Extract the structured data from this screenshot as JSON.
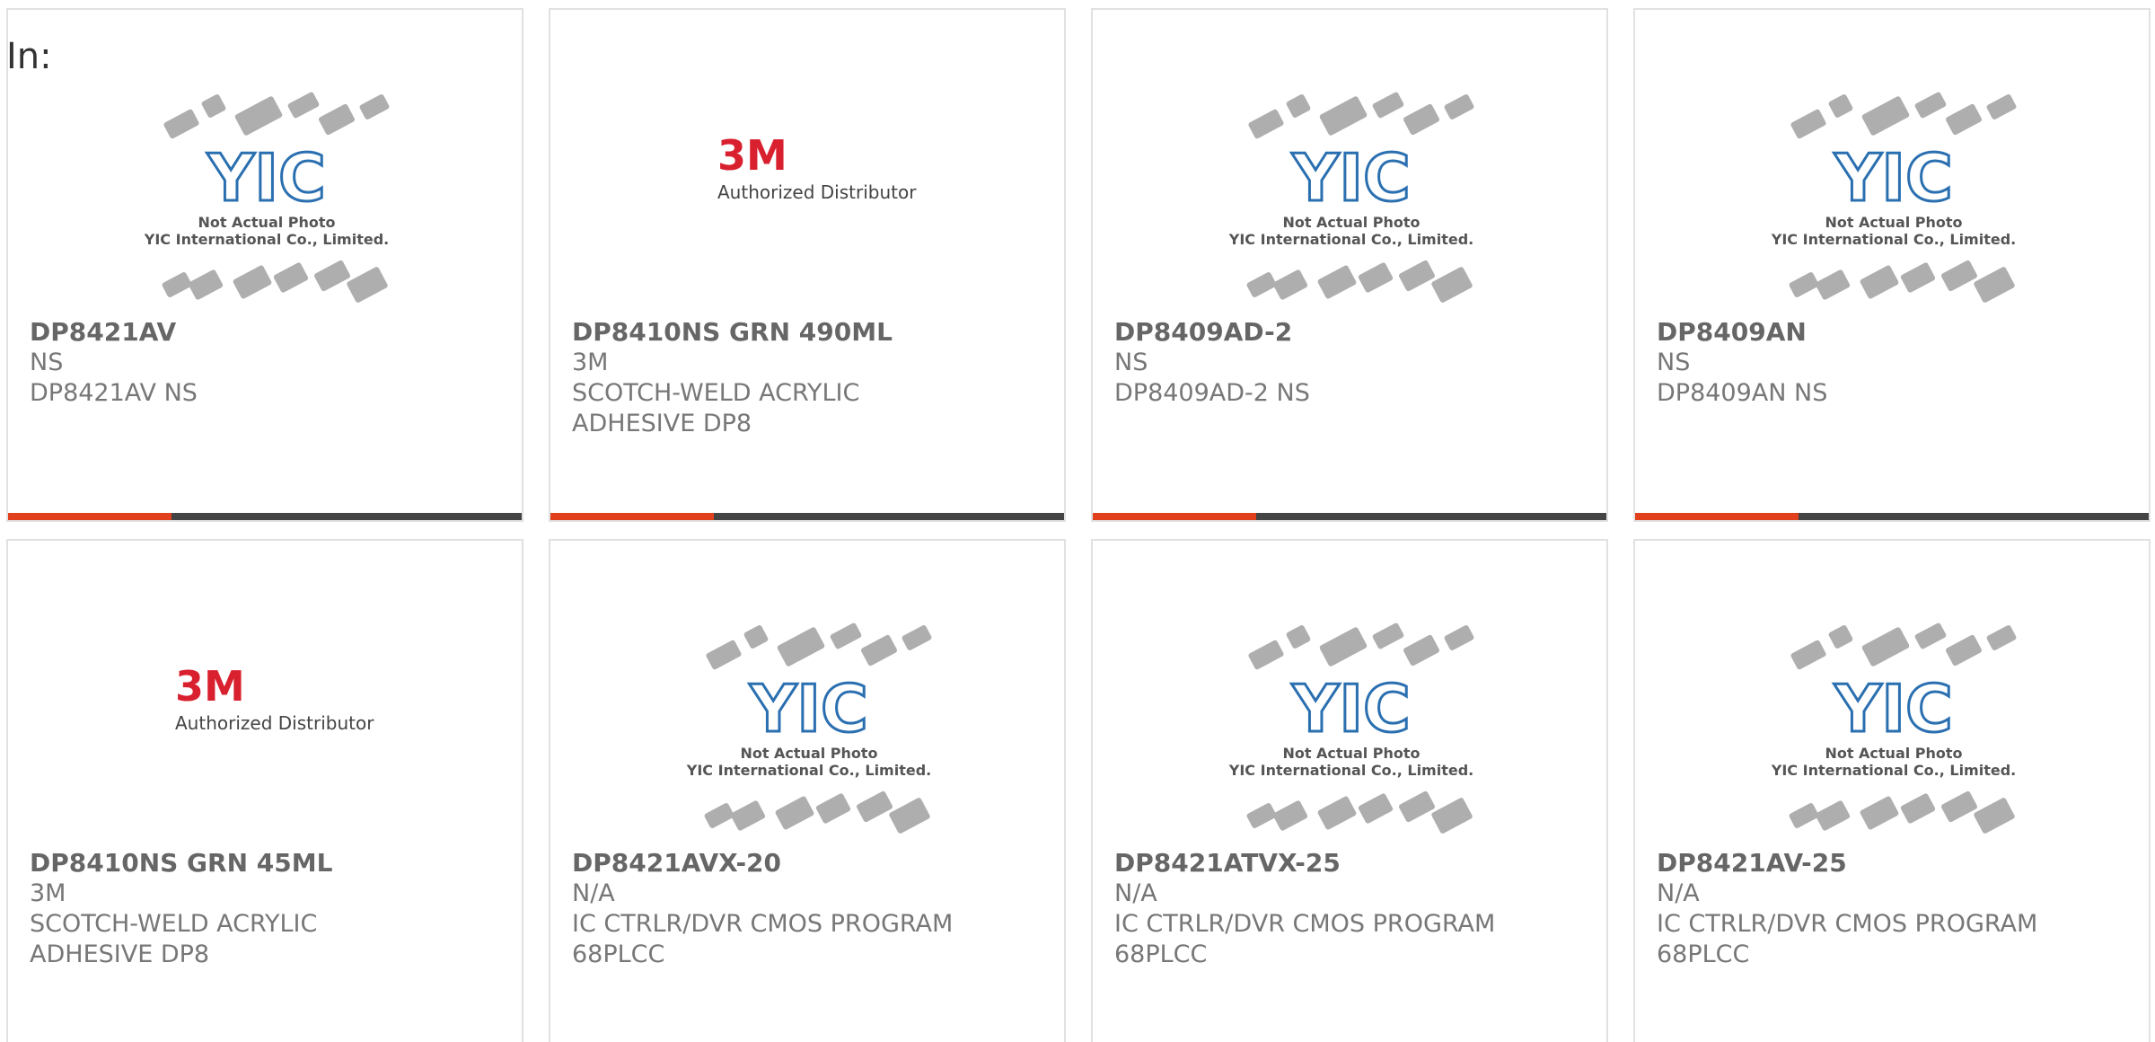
{
  "filter_label": "In:",
  "yic_image": {
    "not_actual": "Not Actual Photo",
    "company": "YIC International Co., Limited."
  },
  "m3_image": {
    "logo": "3M",
    "tagline": "Authorized Distributor"
  },
  "products": [
    {
      "part": "DP8421AV",
      "brand": "NS",
      "desc": "DP8421AV NS",
      "image": "yic"
    },
    {
      "part": "DP8410NS GRN 490ML",
      "brand": "3M",
      "desc": "SCOTCH-WELD ACRYLIC ADHESIVE DP8",
      "image": "3m"
    },
    {
      "part": "DP8409AD-2",
      "brand": "NS",
      "desc": "DP8409AD-2 NS",
      "image": "yic"
    },
    {
      "part": "DP8409AN",
      "brand": "NS",
      "desc": "DP8409AN NS",
      "image": "yic"
    },
    {
      "part": "DP8410NS GRN 45ML",
      "brand": "3M",
      "desc": "SCOTCH-WELD ACRYLIC ADHESIVE DP8",
      "image": "3m"
    },
    {
      "part": "DP8421AVX-20",
      "brand": "N/A",
      "desc": "IC CTRLR/DVR CMOS PROGRAM 68PLCC",
      "image": "yic"
    },
    {
      "part": "DP8421ATVX-25",
      "brand": "N/A",
      "desc": "IC CTRLR/DVR CMOS PROGRAM 68PLCC",
      "image": "yic"
    },
    {
      "part": "DP8421AV-25",
      "brand": "N/A",
      "desc": "IC CTRLR/DVR CMOS PROGRAM 68PLCC",
      "image": "yic"
    }
  ],
  "colors": {
    "accent_red": "#e0411c",
    "bar_dark": "#444444",
    "yic_blue": "#2a6fb0",
    "m3_red": "#d9202f"
  }
}
